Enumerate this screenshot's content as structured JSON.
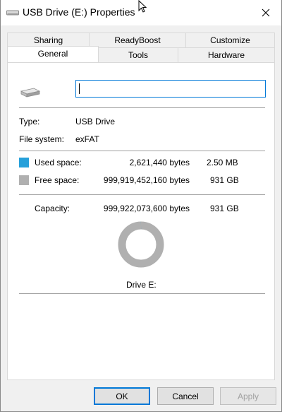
{
  "window": {
    "title": "USB Drive (E:) Properties",
    "close_glyph": "✕"
  },
  "tabs": {
    "back_row": [
      {
        "label": "Sharing"
      },
      {
        "label": "ReadyBoost"
      },
      {
        "label": "Customize"
      }
    ],
    "front_row": [
      {
        "label": "General",
        "active": true
      },
      {
        "label": "Tools"
      },
      {
        "label": "Hardware"
      }
    ]
  },
  "general": {
    "name_value": "",
    "type_label": "Type:",
    "type_value": "USB Drive",
    "fs_label": "File system:",
    "fs_value": "exFAT",
    "used": {
      "label": "Used space:",
      "bytes": "2,621,440 bytes",
      "size": "2.50 MB",
      "color": "#26a0da"
    },
    "free": {
      "label": "Free space:",
      "bytes": "999,919,452,160 bytes",
      "size": "931 GB",
      "color": "#b0b0b0"
    },
    "capacity": {
      "label": "Capacity:",
      "bytes": "999,922,073,600 bytes",
      "size": "931 GB"
    },
    "drive_label": "Drive E:",
    "used_fraction": 2.6e-06
  },
  "buttons": {
    "ok": "OK",
    "cancel": "Cancel",
    "apply": "Apply"
  }
}
